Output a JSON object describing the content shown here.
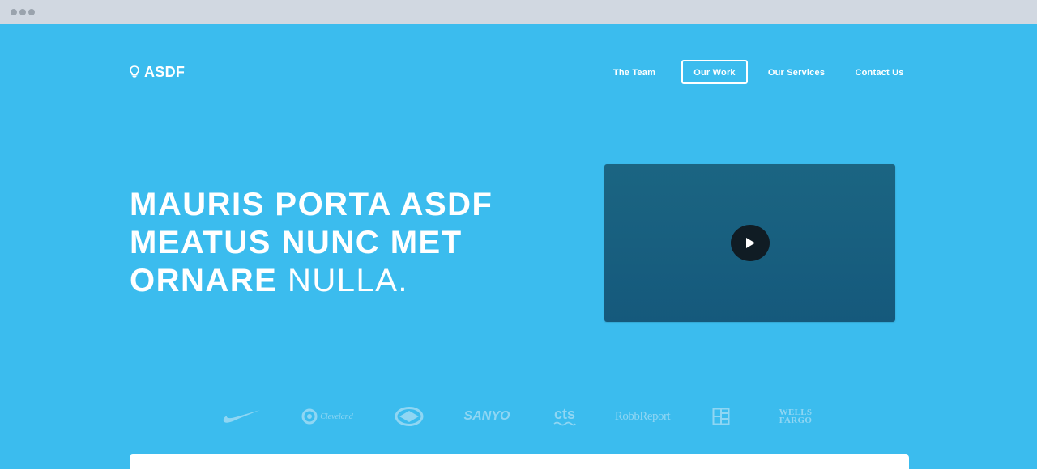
{
  "colors": {
    "background": "#3bbcee",
    "video": "#1a6281",
    "play": "#101c24",
    "logos": "#8fd6f3"
  },
  "brand": {
    "name": "ASDF",
    "icon": "lightbulb-icon"
  },
  "nav": {
    "items": [
      {
        "label": "The Team",
        "active": false
      },
      {
        "label": "Our Work",
        "active": true
      },
      {
        "label": "Our Services",
        "active": false
      },
      {
        "label": "Contact Us",
        "active": false
      }
    ]
  },
  "hero": {
    "line1": "MAURIS PORTA ASDF",
    "line2": "MEATUS NUNC MET",
    "line3_bold": "ORNARE",
    "line3_light": "NULLA."
  },
  "video": {
    "play_icon": "play-icon"
  },
  "client_logos": [
    {
      "name": "Nike",
      "icon": "nike-swoosh-icon"
    },
    {
      "name": "Cleveland",
      "text": "Cleveland"
    },
    {
      "name": "Scion",
      "icon": "scion-logo-icon"
    },
    {
      "name": "Sanyo",
      "text": "SANYO"
    },
    {
      "name": "CTS",
      "text": "cts"
    },
    {
      "name": "Robb Report",
      "text": "RobbReport"
    },
    {
      "name": "Grid",
      "icon": "grid-logo-icon"
    },
    {
      "name": "Wells Fargo",
      "text_line1": "WELLS",
      "text_line2": "FARGO"
    }
  ]
}
